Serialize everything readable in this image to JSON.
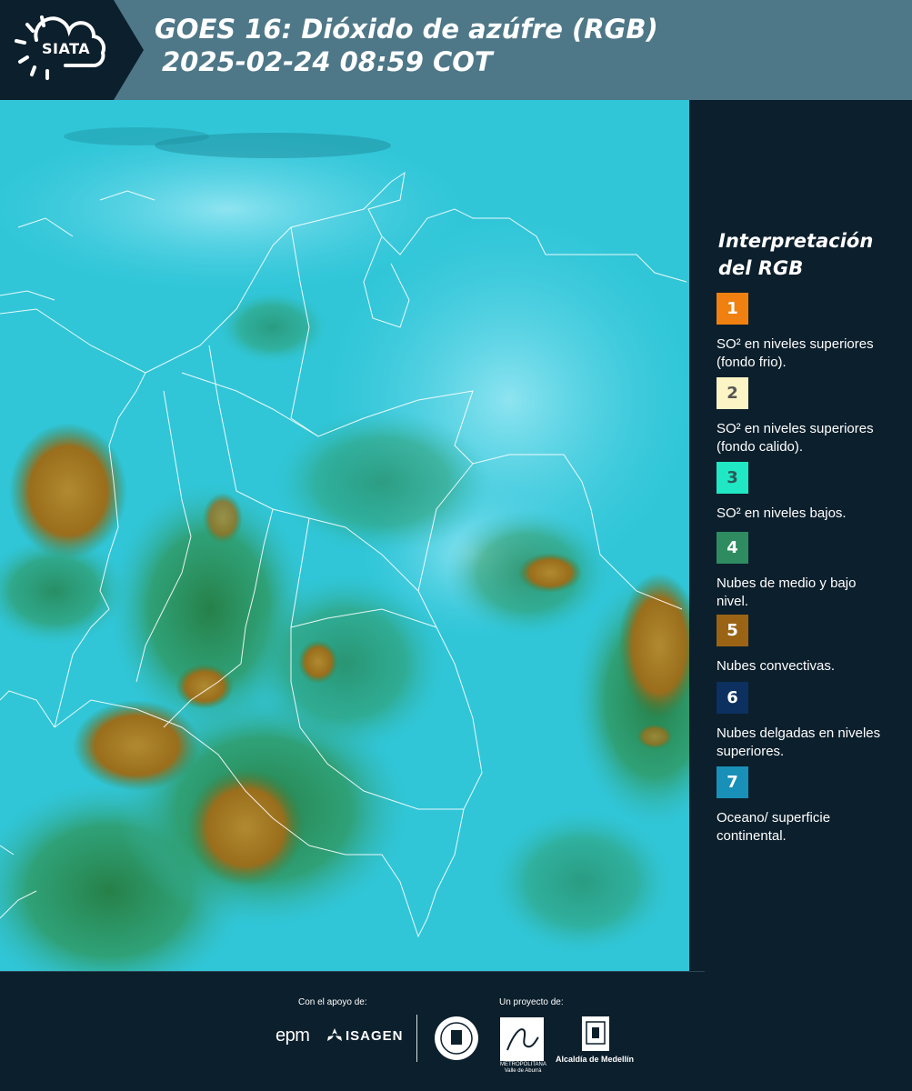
{
  "header": {
    "logo_text": "SIATA",
    "title_line1": "GOES 16: Dióxido de azúfre (RGB)",
    "title_line2": "2025-02-24 08:59 COT"
  },
  "colors": {
    "header_bg": "#4e7888",
    "page_bg": "#0c1f2c",
    "map_cyan": "#30c8d8",
    "map_green": "#2c8a52",
    "map_convective": "#9a6e1c"
  },
  "legend": {
    "title_line1": "Interpretación",
    "title_line2": "del RGB",
    "items": [
      {
        "number": "1",
        "color": "#f08010",
        "number_color": "#ffffff",
        "label": "SO² en niveles superiores (fondo frio)."
      },
      {
        "number": "2",
        "color": "#fcf4c4",
        "number_color": "#555555",
        "label": "SO² en niveles superiores (fondo calido)."
      },
      {
        "number": "3",
        "color": "#20e8c4",
        "number_color": "#2a5a58",
        "label": "SO² en niveles bajos."
      },
      {
        "number": "4",
        "color": "#2e8c60",
        "number_color": "#ffffff",
        "label": "Nubes de medio y bajo nivel."
      },
      {
        "number": "5",
        "color": "#9a6414",
        "number_color": "#ffffff",
        "label": "Nubes convectivas."
      },
      {
        "number": "6",
        "color": "#0c3060",
        "number_color": "#ffffff",
        "label": "Nubes delgadas en niveles superiores."
      },
      {
        "number": "7",
        "color": "#1890b8",
        "number_color": "#ffffff",
        "label": "Oceano/ superficie continental."
      }
    ]
  },
  "footer": {
    "support_label": "Con el apoyo de:",
    "project_label": "Un proyecto de:",
    "sponsor_1": "epm",
    "sponsor_2": "ISAGEN",
    "partner_area_text": "METROPOLITANA Valle de Aburrá",
    "partner_alcaldia": "Alcaldía de Medellín"
  }
}
